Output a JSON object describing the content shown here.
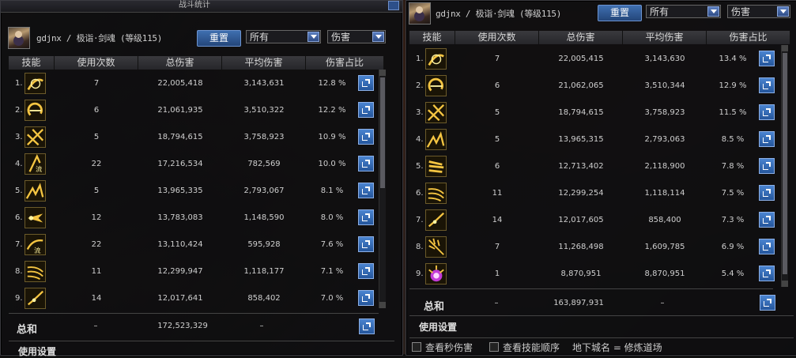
{
  "left": {
    "window_title": "战斗统计",
    "character": "gdjnx / 极诣·剑魂 (等级115)",
    "reset_label": "重置",
    "filter1": "所有",
    "filter2": "伤害",
    "headers": [
      "技能",
      "使用次数",
      "总伤害",
      "平均伤害",
      "伤害占比"
    ],
    "rows": [
      {
        "idx": "1.",
        "uses": "7",
        "total": "22,005,418",
        "avg": "3,143,631",
        "pct": "12.8 %",
        "icon": "sword-slash-skill-icon"
      },
      {
        "idx": "2.",
        "uses": "6",
        "total": "21,061,935",
        "avg": "3,510,322",
        "pct": "12.2 %",
        "icon": "crescent-blade-skill-icon"
      },
      {
        "idx": "3.",
        "uses": "5",
        "total": "18,794,615",
        "avg": "3,758,923",
        "pct": "10.9 %",
        "icon": "cross-slash-skill-icon"
      },
      {
        "idx": "4.",
        "uses": "22",
        "total": "17,216,534",
        "avg": "782,569",
        "pct": "10.0 %",
        "icon": "flow-blade-skill-icon"
      },
      {
        "idx": "5.",
        "uses": "5",
        "total": "13,965,335",
        "avg": "2,793,067",
        "pct": "8.1 %",
        "icon": "burst-strike-skill-icon"
      },
      {
        "idx": "6.",
        "uses": "12",
        "total": "13,783,083",
        "avg": "1,148,590",
        "pct": "8.0 %",
        "icon": "dragon-dash-skill-icon"
      },
      {
        "idx": "7.",
        "uses": "22",
        "total": "13,110,424",
        "avg": "595,928",
        "pct": "7.6 %",
        "icon": "flow-wave-skill-icon"
      },
      {
        "idx": "8.",
        "uses": "11",
        "total": "12,299,947",
        "avg": "1,118,177",
        "pct": "7.1 %",
        "icon": "triple-arc-skill-icon"
      },
      {
        "idx": "9.",
        "uses": "14",
        "total": "12,017,641",
        "avg": "858,402",
        "pct": "7.0 %",
        "icon": "thrust-skill-icon"
      }
    ],
    "sum_label": "总和",
    "sum_uses": "–",
    "sum_total": "172,523,329",
    "sum_avg": "–",
    "usage_settings": "使用设置"
  },
  "right": {
    "character": "gdjnx / 极诣·剑魂 (等级115)",
    "reset_label": "重置",
    "filter1": "所有",
    "filter2": "伤害",
    "headers": [
      "技能",
      "使用次数",
      "总伤害",
      "平均伤害",
      "伤害占比"
    ],
    "rows": [
      {
        "idx": "1.",
        "uses": "7",
        "total": "22,005,415",
        "avg": "3,143,630",
        "pct": "13.4 %",
        "icon": "sword-slash-skill-icon"
      },
      {
        "idx": "2.",
        "uses": "6",
        "total": "21,062,065",
        "avg": "3,510,344",
        "pct": "12.9 %",
        "icon": "crescent-blade-skill-icon"
      },
      {
        "idx": "3.",
        "uses": "5",
        "total": "18,794,615",
        "avg": "3,758,923",
        "pct": "11.5 %",
        "icon": "cross-slash-skill-icon"
      },
      {
        "idx": "4.",
        "uses": "5",
        "total": "13,965,315",
        "avg": "2,793,063",
        "pct": "8.5 %",
        "icon": "burst-strike-skill-icon"
      },
      {
        "idx": "5.",
        "uses": "6",
        "total": "12,713,402",
        "avg": "2,118,900",
        "pct": "7.8 %",
        "icon": "triple-wave-skill-icon"
      },
      {
        "idx": "6.",
        "uses": "11",
        "total": "12,299,254",
        "avg": "1,118,114",
        "pct": "7.5 %",
        "icon": "triple-arc-skill-icon"
      },
      {
        "idx": "7.",
        "uses": "14",
        "total": "12,017,605",
        "avg": "858,400",
        "pct": "7.3 %",
        "icon": "thrust-skill-icon"
      },
      {
        "idx": "8.",
        "uses": "7",
        "total": "11,268,498",
        "avg": "1,609,785",
        "pct": "6.9 %",
        "icon": "sword-rain-skill-icon"
      },
      {
        "idx": "9.",
        "uses": "1",
        "total": "8,870,951",
        "avg": "8,870,951",
        "pct": "5.4 %",
        "icon": "purple-burst-skill-icon"
      }
    ],
    "sum_label": "总和",
    "sum_uses": "–",
    "sum_total": "163,897,931",
    "sum_avg": "–",
    "usage_settings": "使用设置",
    "check_dps": "查看秒伤害",
    "check_order": "查看技能顺序",
    "dungeon": "地下城名 = 修炼道场"
  },
  "colors": {
    "accent_blue": "#3f6fb0",
    "skill_gold": "#f5c542"
  }
}
